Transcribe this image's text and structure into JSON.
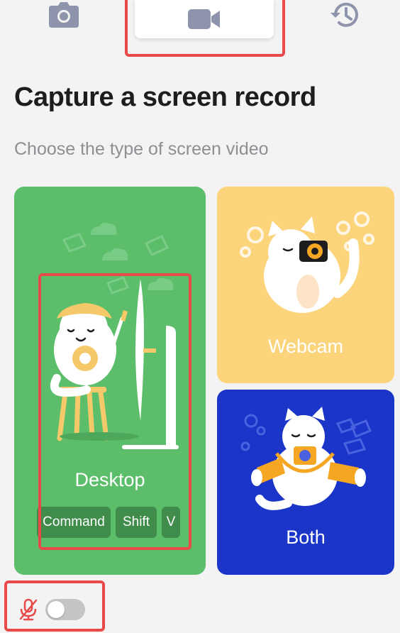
{
  "tabs": [
    {
      "id": "screenshot",
      "icon": "camera-icon"
    },
    {
      "id": "video",
      "icon": "video-camera-icon",
      "active": true
    },
    {
      "id": "history",
      "icon": "history-icon"
    }
  ],
  "heading": {
    "title": "Capture a screen record",
    "subtitle": "Choose the type of screen video"
  },
  "options": {
    "desktop": {
      "label": "Desktop",
      "color": "#5cbd6b",
      "shortcut": [
        "Command",
        "Shift",
        "V"
      ]
    },
    "webcam": {
      "label": "Webcam",
      "color": "#fcd47c"
    },
    "both": {
      "label": "Both",
      "color": "#1a35c8"
    }
  },
  "microphone": {
    "icon": "microphone-muted-icon",
    "enabled": false,
    "muted_color": "#e84a4a"
  },
  "colors": {
    "icon_gray": "#8e94ab",
    "highlight": "#e84a4a",
    "accent_orange": "#f5a623"
  }
}
